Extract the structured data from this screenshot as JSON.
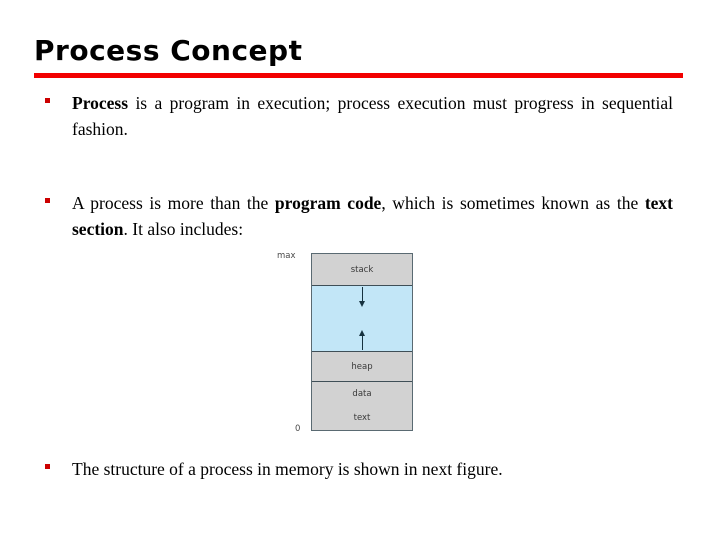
{
  "slide": {
    "title": "Process Concept",
    "rule_color": "#f20000",
    "bullet_marker_color": "#cc0000",
    "bullets": [
      {
        "id": "bullet-1",
        "marker": "square-bullet",
        "segments": [
          {
            "text": "Process",
            "bold": true
          },
          {
            "text": " is a program in execution; process execution must progress in sequential fashion.",
            "bold": false
          }
        ],
        "plain": "Process is a program in execution; process execution must progress in sequential fashion."
      },
      {
        "id": "bullet-2",
        "marker": "square-bullet",
        "segments": [
          {
            "text": "A process is more than the ",
            "bold": false
          },
          {
            "text": "program code",
            "bold": true
          },
          {
            "text": ", which is sometimes known as the ",
            "bold": false
          },
          {
            "text": "text section",
            "bold": true
          },
          {
            "text": ". It also includes:",
            "bold": false
          }
        ],
        "plain": "A process is more than the program code, which is sometimes known as the text section. It also includes:"
      },
      {
        "id": "bullet-3",
        "marker": "square-bullet",
        "segments": [
          {
            "text": "The structure of a process in memory is shown in next figure.",
            "bold": false
          }
        ],
        "plain": "The structure of a process in memory is shown in next figure."
      }
    ]
  },
  "memory_figure": {
    "caption_top": "max",
    "caption_bottom": "0",
    "segment_fill_color": "#d2d2d2",
    "free_fill_color": "#c2e6f7",
    "border_color": "#3f4f57",
    "segments": [
      {
        "name": "stack",
        "label": "stack",
        "fill": "#d2d2d2"
      },
      {
        "name": "free-space",
        "label": "",
        "fill": "#c2e6f7"
      },
      {
        "name": "heap",
        "label": "heap",
        "fill": "#d2d2d2"
      },
      {
        "name": "data",
        "label": "data",
        "fill": "#d2d2d2"
      },
      {
        "name": "text",
        "label": "text",
        "fill": "#d2d2d2"
      }
    ],
    "arrows": [
      {
        "name": "stack-grow-down-arrow",
        "direction": "down"
      },
      {
        "name": "heap-grow-up-arrow",
        "direction": "up"
      }
    ]
  }
}
